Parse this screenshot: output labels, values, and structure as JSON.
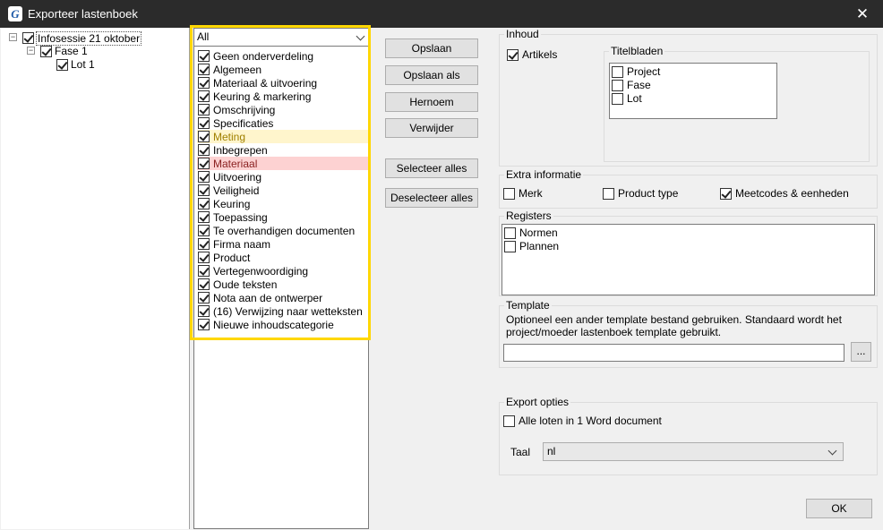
{
  "window": {
    "title": "Exporteer lastenboek",
    "app_icon": "app-logo-icon",
    "close_icon": "close-icon"
  },
  "tree": [
    {
      "label": "Infosessie 21 oktober",
      "checked": true,
      "expander": "⊟"
    },
    {
      "label": "Fase 1",
      "checked": true,
      "expander": "⊟"
    },
    {
      "label": "Lot 1",
      "checked": true
    }
  ],
  "filter": {
    "value": "All"
  },
  "categories": [
    {
      "label": "Geen onderverdeling",
      "checked": true
    },
    {
      "label": "Algemeen",
      "checked": true
    },
    {
      "label": "Materiaal & uitvoering",
      "checked": true
    },
    {
      "label": "Keuring & markering",
      "checked": true
    },
    {
      "label": "Omschrijving",
      "checked": true
    },
    {
      "label": "Specificaties",
      "checked": true
    },
    {
      "label": "Meting",
      "checked": true,
      "highlight": "yellow"
    },
    {
      "label": "Inbegrepen",
      "checked": true
    },
    {
      "label": "Materiaal",
      "checked": true,
      "highlight": "red"
    },
    {
      "label": "Uitvoering",
      "checked": true
    },
    {
      "label": "Veiligheid",
      "checked": true
    },
    {
      "label": "Keuring",
      "checked": true
    },
    {
      "label": "Toepassing",
      "checked": true
    },
    {
      "label": "Te overhandigen documenten",
      "checked": true
    },
    {
      "label": "Firma naam",
      "checked": true
    },
    {
      "label": "Product",
      "checked": true
    },
    {
      "label": "Vertegenwoordiging",
      "checked": true
    },
    {
      "label": "Oude teksten",
      "checked": true
    },
    {
      "label": "Nota aan de ontwerper",
      "checked": true
    },
    {
      "label": "(16)  Verwijzing naar wetteksten",
      "checked": true
    },
    {
      "label": "Nieuwe inhoudscategorie",
      "checked": true
    }
  ],
  "buttons": {
    "opslaan": "Opslaan",
    "opslaan_als": "Opslaan als",
    "hernoem": "Hernoem",
    "verwijder": "Verwijder",
    "selecteer_alles": "Selecteer alles",
    "deselecteer_alles": "Deselecteer alles",
    "browse": "...",
    "ok": "OK"
  },
  "inhoud": {
    "title": "Inhoud",
    "artikels": {
      "label": "Artikels",
      "checked": true
    },
    "titelbladen": {
      "title": "Titelbladen",
      "items": [
        {
          "label": "Project",
          "checked": false
        },
        {
          "label": "Fase",
          "checked": false
        },
        {
          "label": "Lot",
          "checked": false
        }
      ]
    }
  },
  "extra": {
    "title": "Extra informatie",
    "merk": {
      "label": "Merk",
      "checked": false
    },
    "product_type": {
      "label": "Product type",
      "checked": false
    },
    "meetcodes": {
      "label": "Meetcodes & eenheden",
      "checked": true
    }
  },
  "registers": {
    "title": "Registers",
    "items": [
      {
        "label": "Normen",
        "checked": false
      },
      {
        "label": "Plannen",
        "checked": false
      }
    ]
  },
  "template": {
    "title": "Template",
    "description_line1": "Optioneel een ander template bestand gebruiken. Standaard wordt het",
    "description_line2": "project/moeder lastenboek template gebruikt.",
    "path_value": ""
  },
  "export": {
    "title": "Export opties",
    "alle_loten": {
      "label": "Alle loten in 1 Word document",
      "checked": false
    },
    "taal_label": "Taal",
    "taal_value": "nl"
  },
  "colors": {
    "highlight_border": "#ffd700",
    "meting_bg": "#fff5cc",
    "materiaal_bg": "#fdd2d2"
  }
}
